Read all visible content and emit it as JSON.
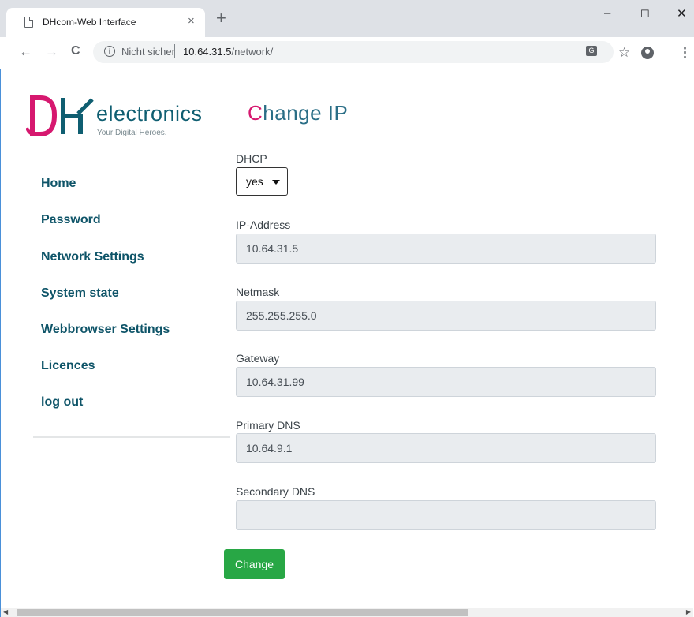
{
  "browser": {
    "tab_title": "DHcom-Web Interface",
    "tab_close": "×",
    "new_tab": "+",
    "window_controls": {
      "minimize": "–",
      "maximize": "☐",
      "close": "✕"
    },
    "nav": {
      "back": "←",
      "forward": "→",
      "reload": "C"
    },
    "security_label": "Nicht sicher",
    "url_host": "10.64.31.5",
    "url_path": "/network/",
    "star": "☆",
    "menu": "⋮"
  },
  "logo": {
    "electronics": "electronics",
    "tagline": "Your Digital Heroes.",
    "colors": {
      "magenta": "#d6186f",
      "teal": "#0f5e71"
    }
  },
  "page": {
    "title_first": "C",
    "title_rest": "hange IP"
  },
  "sidebar": {
    "items": [
      {
        "label": "Home"
      },
      {
        "label": "Password"
      },
      {
        "label": "Network Settings"
      },
      {
        "label": "System state"
      },
      {
        "label": "Webbrowser Settings"
      },
      {
        "label": "Licences"
      },
      {
        "label": "log out"
      }
    ]
  },
  "form": {
    "dhcp": {
      "label": "DHCP",
      "value": "yes"
    },
    "ip": {
      "label": "IP-Address",
      "value": "10.64.31.5"
    },
    "netmask": {
      "label": "Netmask",
      "value": "255.255.255.0"
    },
    "gateway": {
      "label": "Gateway",
      "value": "10.64.31.99"
    },
    "primary_dns": {
      "label": "Primary DNS",
      "value": "10.64.9.1"
    },
    "secondary_dns": {
      "label": "Secondary DNS",
      "value": ""
    },
    "submit_label": "Change",
    "submit_color": "#28a745"
  }
}
